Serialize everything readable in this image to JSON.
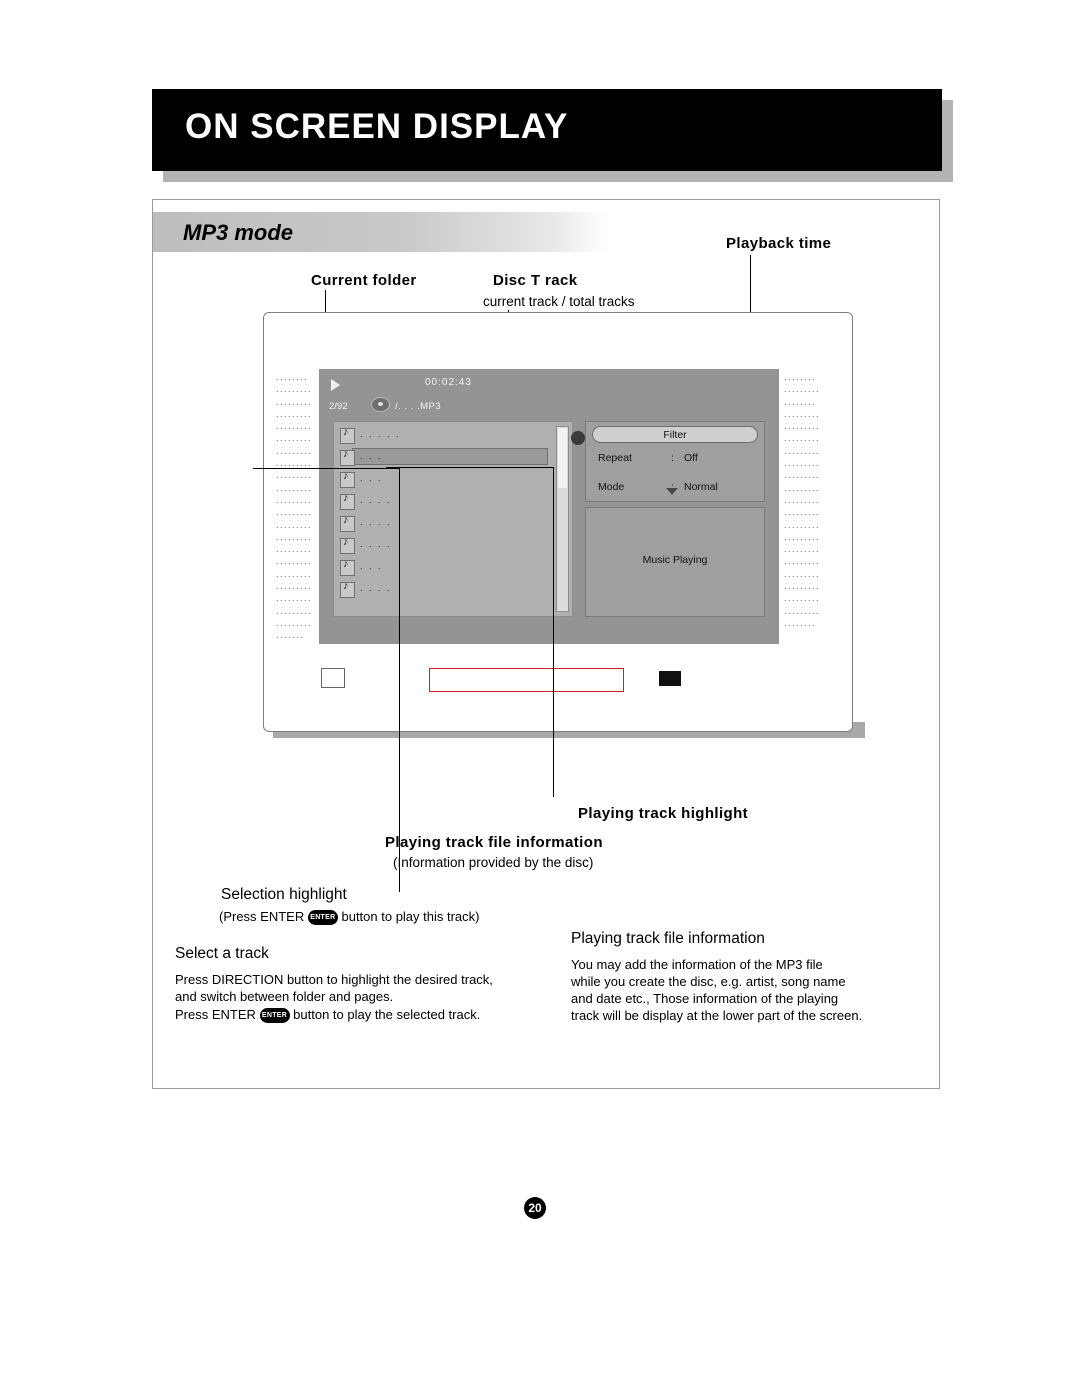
{
  "header": {
    "title": "ON SCREEN DISPLAY"
  },
  "ribbon": {
    "label": "MP3 mode"
  },
  "callouts": {
    "playback_time": "Playback  time",
    "current_folder": "Current folder",
    "disc_track": "Disc T rack",
    "disc_track_sub": "current track / total tracks",
    "playing_track_highlight": "Playing track  highlight",
    "playing_track_file_information": "Playing track   file information",
    "playing_track_file_information_sub": "(Information provided by  the disc)",
    "selection_highlight": "Selection highlight",
    "selection_highlight_pre": "(Press  ENTER",
    "selection_highlight_post": "button to play   this track)"
  },
  "screen": {
    "time": "00:02:43",
    "track_counter": "2/92",
    "path": "/. . . .MP3",
    "filter_label": "Filter",
    "repeat_key": "Repeat",
    "repeat_sep": ":",
    "repeat_value": "Off",
    "mode_key": "Mode",
    "mode_sep": ":",
    "mode_value": "Normal",
    "music_playing": "Music Playing",
    "list_rows": [
      ". . . . .",
      ". . .",
      ". . .",
      ". . . .",
      ". . . .",
      ". . . .",
      ". . .",
      ". . . ."
    ],
    "dots_column": "........\n.........\n.........\n.........\n.........\n.........\n.........\n.........\n.........\n.........\n.........\n.........\n.........\n.........\n.........\n.........\n.........\n.........\n.........\n.........\n.........\n.......",
    "dots_column_right": "........\n.........\n........\n.........\n.........\n.........\n.........\n.........\n.........\n.........\n.........\n.........\n.........\n.........\n.........\n.........\n.........\n.........\n.........\n.........\n........"
  },
  "select_track": {
    "heading": "Select a  track",
    "line1": "Press  DIRECTION   button to highlight the desired track,",
    "line2": "and  switch between folder and pages.",
    "line3_pre": "Press  ENTER",
    "line3_post": "button to play  the selected track."
  },
  "playing_info": {
    "heading": "Playing track  file information",
    "line1": "You  may add the  information of the  MP3 file",
    "line2": "while you create   the disc, e.g.  artist, song name",
    "line3": "and date etc.,   Those information of   the playing",
    "line4": "track will be  display at the  lower part of  the screen."
  },
  "enter_key_label": "ENTER",
  "page_number": "20"
}
